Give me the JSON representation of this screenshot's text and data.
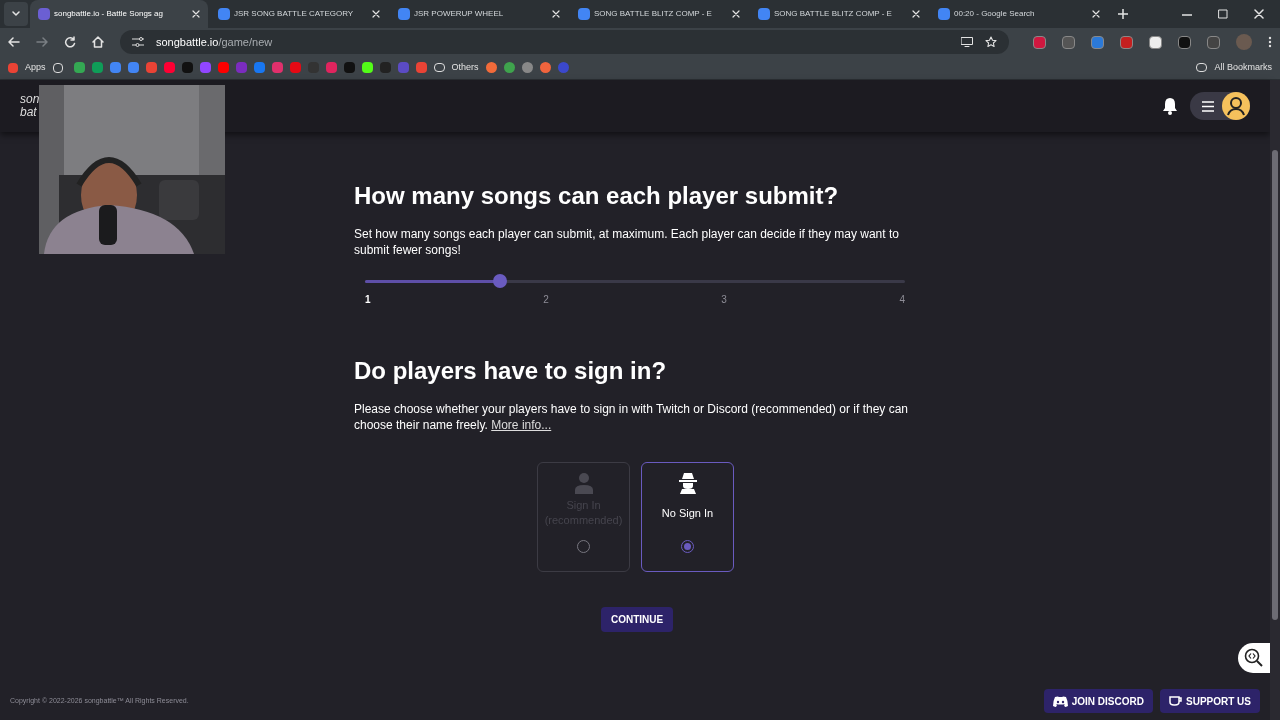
{
  "browser": {
    "tabs": [
      {
        "title": "songbattle.io - Battle Songs ag",
        "selected": true
      },
      {
        "title": "JSR SONG BATTLE CATEGORY",
        "selected": false
      },
      {
        "title": "JSR POWERUP WHEEL",
        "selected": false
      },
      {
        "title": "SONG BATTLE BLITZ COMP - E",
        "selected": false
      },
      {
        "title": "SONG BATTLE BLITZ COMP - E",
        "selected": false
      },
      {
        "title": "00:20 - Google Search",
        "selected": false
      }
    ],
    "url": {
      "host": "songbattle.io",
      "path": "/game/new"
    },
    "bookmarks": {
      "apps": "Apps",
      "folder": "Others",
      "all": "All Bookmarks"
    }
  },
  "header": {
    "logo": [
      "son",
      "bat"
    ]
  },
  "songs": {
    "title": "How many songs can each player submit?",
    "text": "Set how many songs each player can submit, at maximum. Each player can decide if they may want to submit fewer songs!",
    "slider": {
      "level": 0.25,
      "ticks": [
        {
          "label": "1",
          "selected": true
        },
        {
          "label": "2",
          "selected": false
        },
        {
          "label": "3",
          "selected": false
        },
        {
          "label": "4",
          "selected": false
        }
      ]
    }
  },
  "signin": {
    "title": "Do players have to sign in?",
    "text": "Please choose whether your players have to sign in with Twitch or Discord (recommended) or if they can choose their name freely.",
    "link": "More info...",
    "options": [
      {
        "kind": "person",
        "label": "Sign In (recommended)",
        "selected": false,
        "disabled": true
      },
      {
        "kind": "spy",
        "label": "No Sign In",
        "selected": true,
        "disabled": false
      }
    ]
  },
  "continue": "CONTINUE",
  "footer": {
    "copyright": "Copyright © 2022-2026 songbattle™ All Rights Reserved.",
    "discord": "JOIN DISCORD",
    "support": "SUPPORT US"
  }
}
